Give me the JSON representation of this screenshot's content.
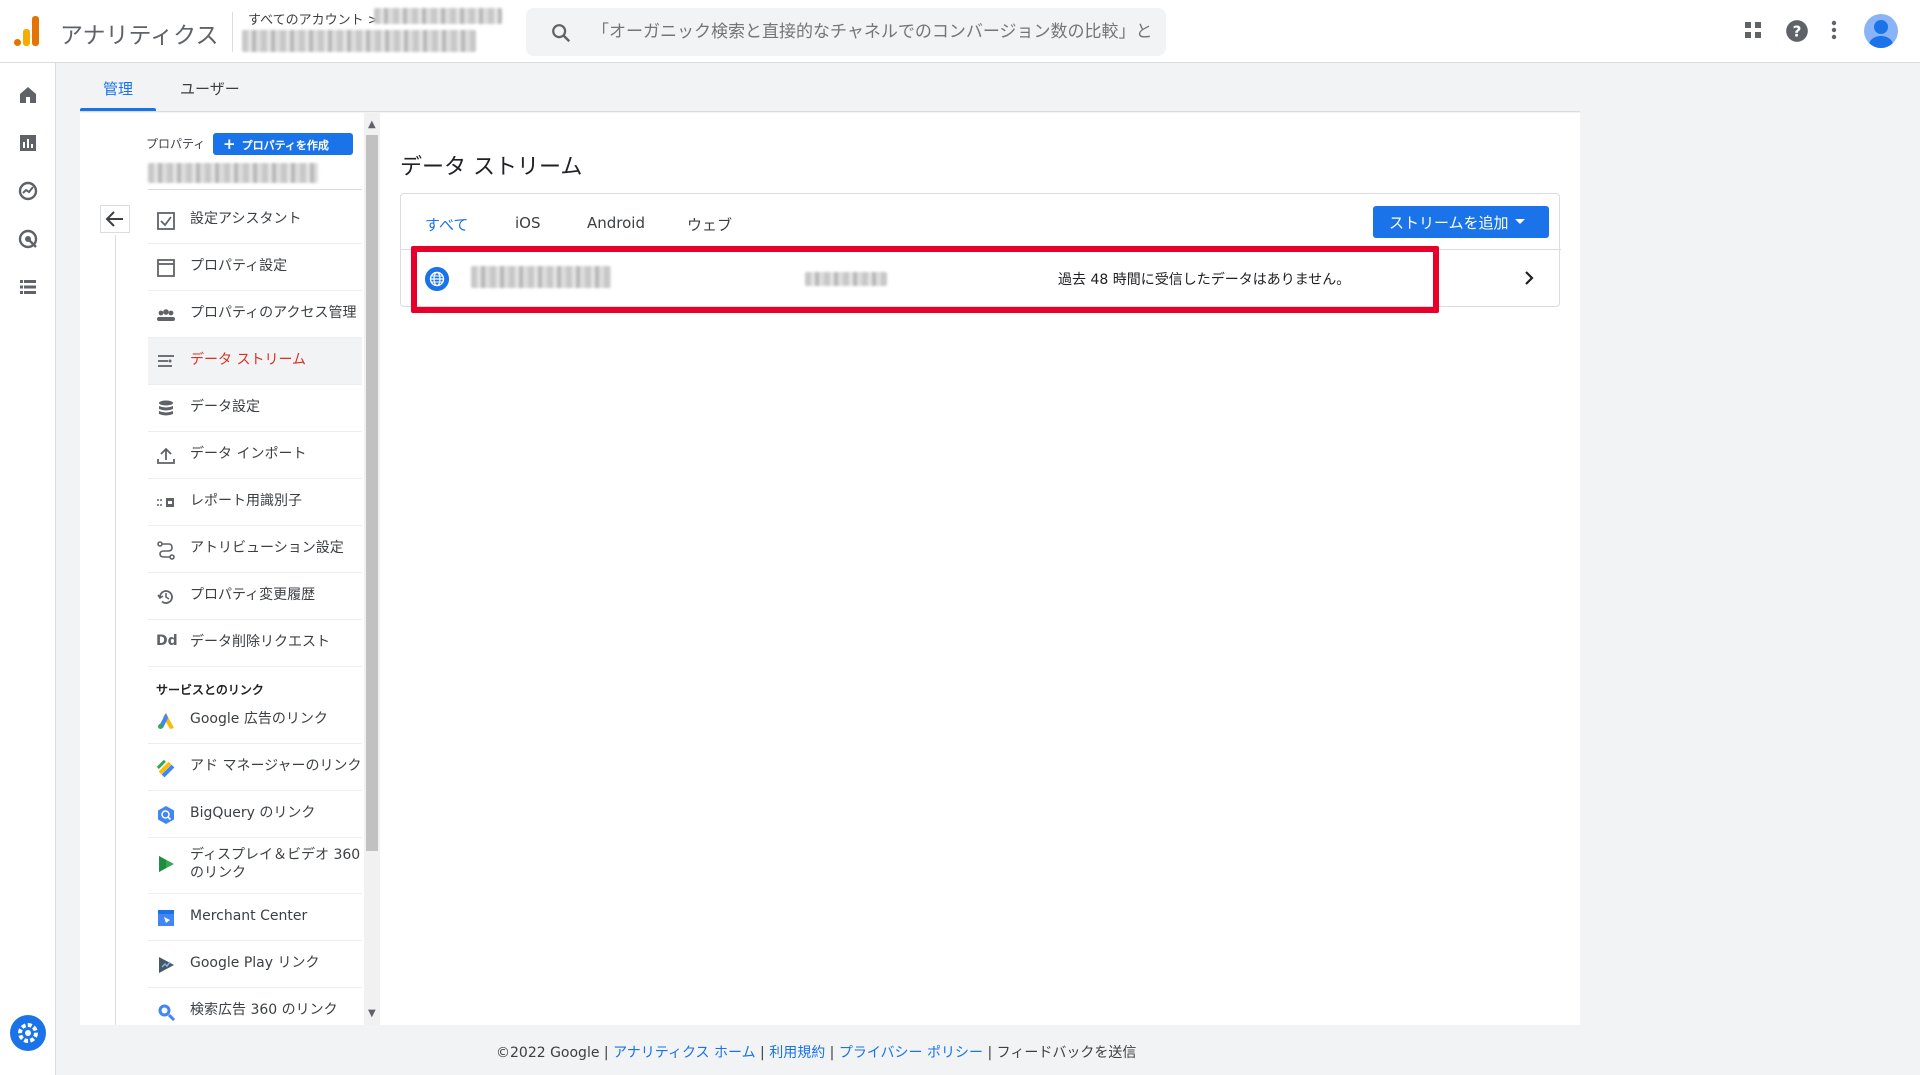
{
  "app": {
    "name": "アナリティクス"
  },
  "breadcrumb": {
    "all_accounts": "すべてのアカウント >"
  },
  "search": {
    "placeholder": "「オーガニック検索と直接的なチャネルでのコンバージョン数の比較」と検..."
  },
  "admin_tabs": [
    {
      "label": "管理"
    },
    {
      "label": "ユーザー"
    }
  ],
  "property": {
    "label": "プロパティ",
    "create_button": "プロパティを作成"
  },
  "nav": {
    "items": [
      {
        "label": "設定アシスタント",
        "icon": "checkbox-icon"
      },
      {
        "label": "プロパティ設定",
        "icon": "property-icon"
      },
      {
        "label": "プロパティのアクセス管理",
        "icon": "people-icon"
      },
      {
        "label": "データ ストリーム",
        "icon": "stream-icon"
      },
      {
        "label": "データ設定",
        "icon": "database-icon"
      },
      {
        "label": "データ インポート",
        "icon": "upload-icon"
      },
      {
        "label": "レポート用識別子",
        "icon": "identifier-icon"
      },
      {
        "label": "アトリビューション設定",
        "icon": "attribution-icon"
      },
      {
        "label": "プロパティ変更履歴",
        "icon": "history-icon"
      },
      {
        "label": "データ削除リクエスト",
        "icon": "data-delete-icon"
      }
    ],
    "dd_glyph": "Dd",
    "section_title": "サービスとのリンク",
    "links": [
      {
        "label": "Google 広告のリンク",
        "icon": "google-ads-icon"
      },
      {
        "label": "アド マネージャーのリンク",
        "icon": "ad-manager-icon"
      },
      {
        "label": "BigQuery のリンク",
        "icon": "bigquery-icon"
      },
      {
        "label": "ディスプレイ＆ビデオ 360 のリンク",
        "icon": "dv360-icon"
      },
      {
        "label": "Merchant Center",
        "icon": "merchant-center-icon"
      },
      {
        "label": "Google Play リンク",
        "icon": "google-play-icon"
      },
      {
        "label": "検索広告 360 のリンク",
        "icon": "search-ads-icon"
      }
    ]
  },
  "content": {
    "title": "データ ストリーム",
    "filter_tabs": [
      {
        "label": "すべて"
      },
      {
        "label": "iOS"
      },
      {
        "label": "Android"
      },
      {
        "label": "ウェブ"
      }
    ],
    "add_stream_button": "ストリームを追加",
    "stream_row": {
      "status": "過去 48 時間に受信したデータはありません。"
    }
  },
  "footer": {
    "copyright": "©2022 Google |",
    "links": [
      "アナリティクス ホーム",
      "利用規約",
      "プライバシー ポリシー"
    ],
    "separator": "|",
    "feedback": "フィードバックを送信"
  },
  "colors": {
    "accent": "#1a73e8",
    "highlight": "#e8002b",
    "active_nav": "#d93025"
  }
}
